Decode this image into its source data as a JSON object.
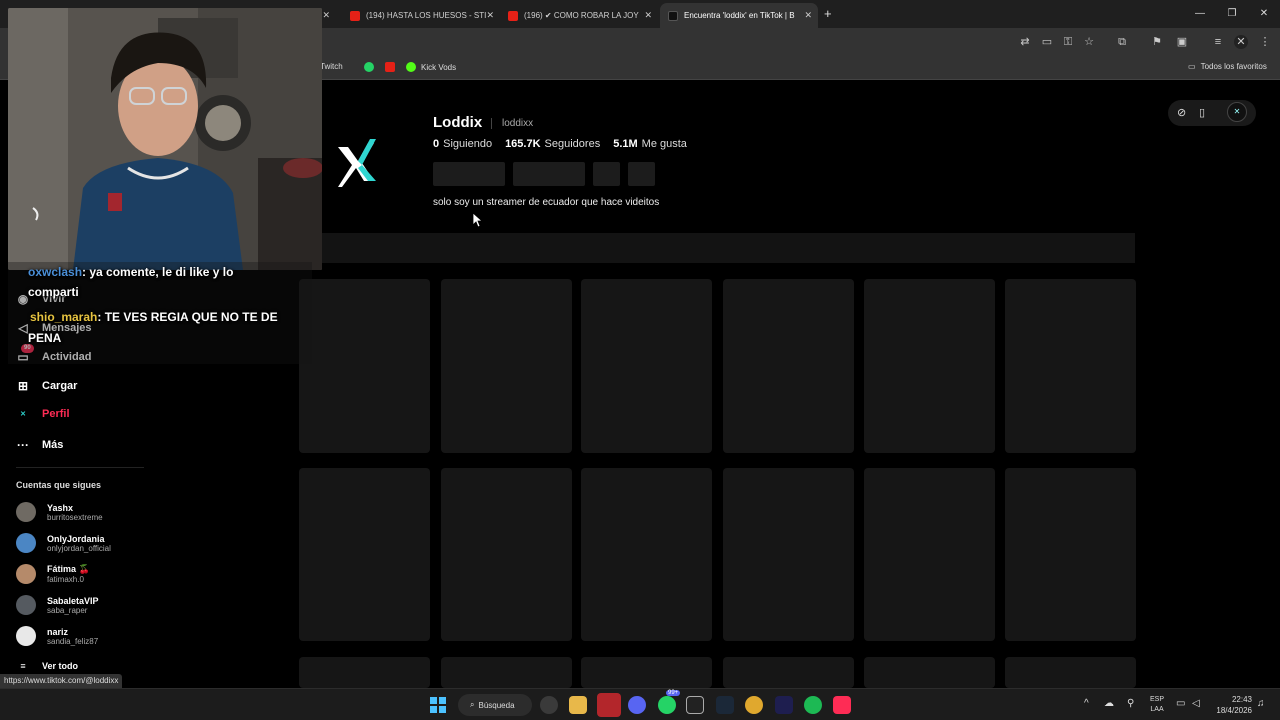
{
  "browser": {
    "tabs": [
      {
        "title": "(194) HASTA LOS HUESOS - STI"
      },
      {
        "title": "(196) ✔ COMO ROBAR LA JOY"
      },
      {
        "title": "Encuentra 'loddix' en TikTok | B"
      }
    ],
    "new_tab_icon": "+",
    "bookmarks": [
      {
        "label": "Twitch"
      },
      {
        "label": ""
      },
      {
        "label": ""
      },
      {
        "label": "Kick Vods"
      }
    ],
    "all_favorites": "Todos los favoritos",
    "status_url": "https://www.tiktok.com/@loddixx"
  },
  "profile": {
    "name": "Loddix",
    "handle": "loddixx",
    "following_count": "0",
    "following_label": "Siguiendo",
    "followers_count": "165.7K",
    "followers_label": "Seguidores",
    "likes_count": "5.1M",
    "likes_label": "Me gusta",
    "bio": "solo soy un streamer de ecuador que hace videitos"
  },
  "sidebar": {
    "items": [
      {
        "label": "Vivir",
        "icon": "live-icon"
      },
      {
        "label": "Mensajes",
        "icon": "send-icon"
      },
      {
        "label": "Actividad",
        "icon": "inbox-icon",
        "badge": "90"
      },
      {
        "label": "Cargar",
        "icon": "plus-square-icon"
      },
      {
        "label": "Perfil",
        "icon": "avatar-icon"
      },
      {
        "label": "Más",
        "icon": "more-icon"
      }
    ],
    "following_title": "Cuentas que sigues",
    "accounts": [
      {
        "name": "Yashx",
        "handle": "burritosextreme"
      },
      {
        "name": "OnlyJordania",
        "handle": "onlyjordan_official"
      },
      {
        "name": "Fátima 🍒",
        "handle": "fatimaxh.0"
      },
      {
        "name": "SabaletaVIP",
        "handle": "saba_raper"
      },
      {
        "name": "nariz",
        "handle": "sandia_feliz87"
      }
    ],
    "see_all": "Ver todo"
  },
  "chat": [
    {
      "user": "oxwclash",
      "message": ": ya comente, le di like y lo",
      "cont": "comparti"
    },
    {
      "user": "shio_marah",
      "message": ": TE VES REGIA QUE NO TE DE",
      "cont": "PENA"
    }
  ],
  "taskbar": {
    "search_label": "Búsqueda",
    "lang_line1": "ESP",
    "lang_line2": "LAA",
    "time": "22:43",
    "date": "18/4/2026",
    "discord_badge": "99+"
  },
  "colors": {
    "accent_red": "#fe2c55",
    "chat_user_blue": "#4a8fd8",
    "chat_user_yellow": "#e6c340"
  }
}
